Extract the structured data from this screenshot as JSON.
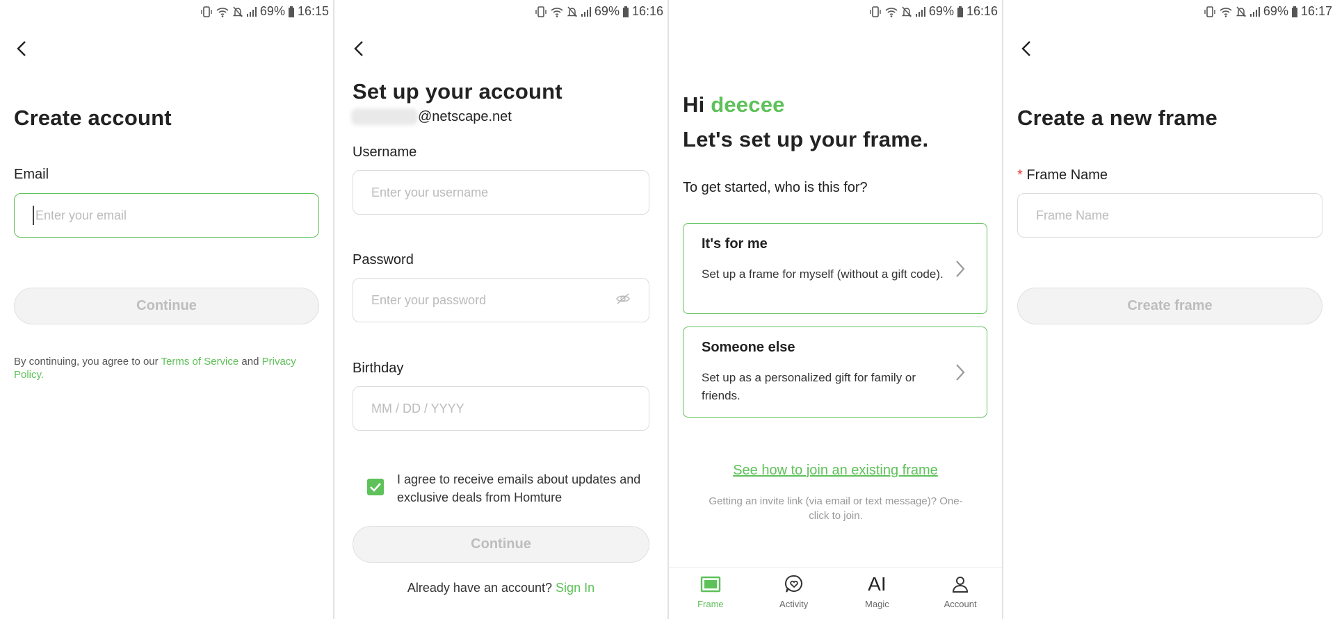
{
  "colors": {
    "accent": "#5ec15a",
    "text": "#222222",
    "placeholder": "#bbbbbb",
    "disabled_bg": "#f3f3f3"
  },
  "status_icons": [
    "vibrate-icon",
    "wifi-icon",
    "no-notifications-icon",
    "signal-icon",
    "battery-icon"
  ],
  "screens": [
    {
      "status": {
        "battery": "69%",
        "time": "16:15"
      },
      "title": "Create account",
      "email_label": "Email",
      "email_placeholder": "Enter your email",
      "continue_label": "Continue",
      "terms_prefix": "By continuing, you agree to our ",
      "terms_link": "Terms of Service",
      "terms_and": " and ",
      "privacy_link": "Privacy Policy",
      "terms_suffix": "."
    },
    {
      "status": {
        "battery": "69%",
        "time": "16:16"
      },
      "title": "Set up your account",
      "email_suffix": "@netscape.net",
      "username_label": "Username",
      "username_placeholder": "Enter your username",
      "password_label": "Password",
      "password_placeholder": "Enter your password",
      "birthday_label": "Birthday",
      "birthday_placeholder": "MM / DD / YYYY",
      "consent_checked": true,
      "consent_text": "I agree to receive emails about updates and exclusive deals from Homture",
      "continue_label": "Continue",
      "signin_prefix": "Already have an account? ",
      "signin_link": "Sign In"
    },
    {
      "status": {
        "battery": "69%",
        "time": "16:16"
      },
      "greeting": "Hi",
      "username": "deecee",
      "subtitle": "Let's set up your frame.",
      "question": "To get started, who is this for?",
      "options": [
        {
          "title": "It's for me",
          "desc": "Set up a frame for myself (without a gift code)."
        },
        {
          "title": "Someone else",
          "desc": "Set up as a personalized gift for family or friends."
        }
      ],
      "join_link": "See how to join an existing frame",
      "invite_note": "Getting an invite link (via email or text message)? One-click to join.",
      "nav": [
        {
          "label": "Frame",
          "icon": "frame-icon",
          "active": true
        },
        {
          "label": "Activity",
          "icon": "activity-icon",
          "active": false
        },
        {
          "label": "Magic",
          "icon": "ai-magic-icon",
          "icon_text": "AI",
          "active": false
        },
        {
          "label": "Account",
          "icon": "account-icon",
          "active": false
        }
      ]
    },
    {
      "status": {
        "battery": "69%",
        "time": "16:17"
      },
      "title": "Create a new frame",
      "required_mark": "*",
      "frame_label": "Frame Name",
      "frame_placeholder": "Frame Name",
      "create_label": "Create frame"
    }
  ]
}
